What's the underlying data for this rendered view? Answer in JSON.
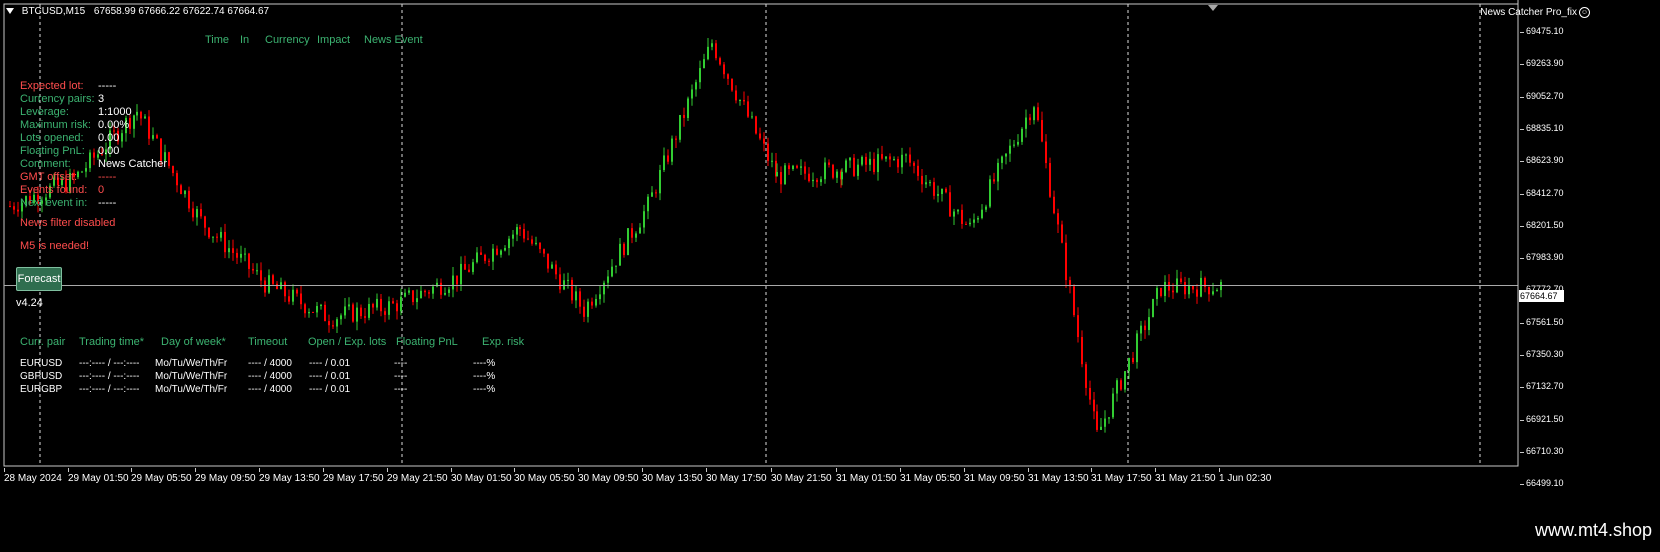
{
  "header": {
    "symbol": "BTCUSD,M15",
    "ohlc": "67658.99 67666.22 67622.74 67664.67"
  },
  "expert": {
    "name": "News Catcher Pro_fix"
  },
  "news_columns": [
    "Time",
    "In",
    "Currency",
    "Impact",
    "News Event"
  ],
  "info_rows": [
    {
      "label": "Expected lot:",
      "value": "-----",
      "color": "red"
    },
    {
      "label": "Currency pairs:",
      "value": "3",
      "color": "green"
    },
    {
      "label": "Leverage:",
      "value": "1:1000",
      "color": "green"
    },
    {
      "label": "Maximum risk:",
      "value": "0.00%",
      "color": "green"
    },
    {
      "label": "Lots opened:",
      "value": "0.00",
      "color": "green"
    },
    {
      "label": "Floating PnL:",
      "value": "0.00",
      "color": "green"
    },
    {
      "label": "Comment:",
      "value": "News Catcher",
      "color": "green"
    },
    {
      "label": "GMT offset:",
      "value": "-----",
      "color": "red"
    },
    {
      "label": "Events found:",
      "value": "0",
      "color": "red"
    },
    {
      "label": "Next event in:",
      "value": "-----",
      "color": "green"
    }
  ],
  "messages": {
    "filter": "News filter disabled",
    "m5": "M5 is needed!"
  },
  "forecast_button": "Forecast",
  "version": "v4.24",
  "table": {
    "headers": [
      "Curr. pair",
      "Trading time*",
      "Day of week*",
      "Timeout",
      "Open / Exp. lots",
      "Floating PnL",
      "Exp. risk"
    ],
    "rows": [
      [
        "EURUSD",
        "---:---- / ---:----",
        "Mo/Tu/We/Th/Fr",
        "---- / 4000",
        "---- / 0.01",
        "----",
        "----%"
      ],
      [
        "GBPUSD",
        "---:---- / ---:----",
        "Mo/Tu/We/Th/Fr",
        "---- / 4000",
        "---- / 0.01",
        "----",
        "----%"
      ],
      [
        "EURGBP",
        "---:---- / ---:----",
        "Mo/Tu/We/Th/Fr",
        "---- / 4000",
        "---- / 0.01",
        "----",
        "----%"
      ]
    ]
  },
  "price_axis": [
    "69475.10",
    "69263.90",
    "69052.70",
    "68835.10",
    "68623.90",
    "68412.70",
    "68201.50",
    "67983.90",
    "67772.70",
    "67561.50",
    "67350.30",
    "67132.70",
    "66921.50",
    "66710.30",
    "66499.10"
  ],
  "current_price": "67664.67",
  "time_axis": [
    "28 May 2024",
    "29 May 01:50",
    "29 May 05:50",
    "29 May 09:50",
    "29 May 13:50",
    "29 May 17:50",
    "29 May 21:50",
    "30 May 01:50",
    "30 May 05:50",
    "30 May 09:50",
    "30 May 13:50",
    "30 May 17:50",
    "30 May 21:50",
    "31 May 01:50",
    "31 May 05:50",
    "31 May 09:50",
    "31 May 13:50",
    "31 May 17:50",
    "31 May 21:50",
    "1 Jun 02:30"
  ],
  "watermark": "www.mt4.shop",
  "colors": {
    "bull": "#32cd32",
    "bear": "#ff0000",
    "background": "#000000",
    "axis": "#c8c8c8",
    "label_green": "#3cb371",
    "label_red": "#ff4d4d"
  },
  "chart_data": {
    "type": "candlestick",
    "title": "BTCUSD,M15",
    "ylim": [
      66450,
      69560
    ],
    "close_path": [
      {
        "x": "28 May 2024",
        "y": 68200
      },
      {
        "x": "29 May 01:50",
        "y": 68380
      },
      {
        "x": "29 May 05:50",
        "y": 68840
      },
      {
        "x": "29 May 09:50",
        "y": 68100
      },
      {
        "x": "29 May 13:50",
        "y": 67680
      },
      {
        "x": "29 May 17:50",
        "y": 67450
      },
      {
        "x": "29 May 21:50",
        "y": 67530
      },
      {
        "x": "30 May 01:50",
        "y": 67720
      },
      {
        "x": "30 May 05:50",
        "y": 68050
      },
      {
        "x": "30 May 09:50",
        "y": 67500
      },
      {
        "x": "30 May 13:50",
        "y": 68200
      },
      {
        "x": "30 May 17:50",
        "y": 69300
      },
      {
        "x": "30 May 21:50",
        "y": 68400
      },
      {
        "x": "31 May 01:50",
        "y": 68450
      },
      {
        "x": "31 May 05:50",
        "y": 68520
      },
      {
        "x": "31 May 09:50",
        "y": 68050
      },
      {
        "x": "31 May 13:50",
        "y": 68900
      },
      {
        "x": "31 May 17:50",
        "y": 66650
      },
      {
        "x": "31 May 21:50",
        "y": 67650
      },
      {
        "x": "1 Jun 02:30",
        "y": 67664.67
      }
    ]
  }
}
